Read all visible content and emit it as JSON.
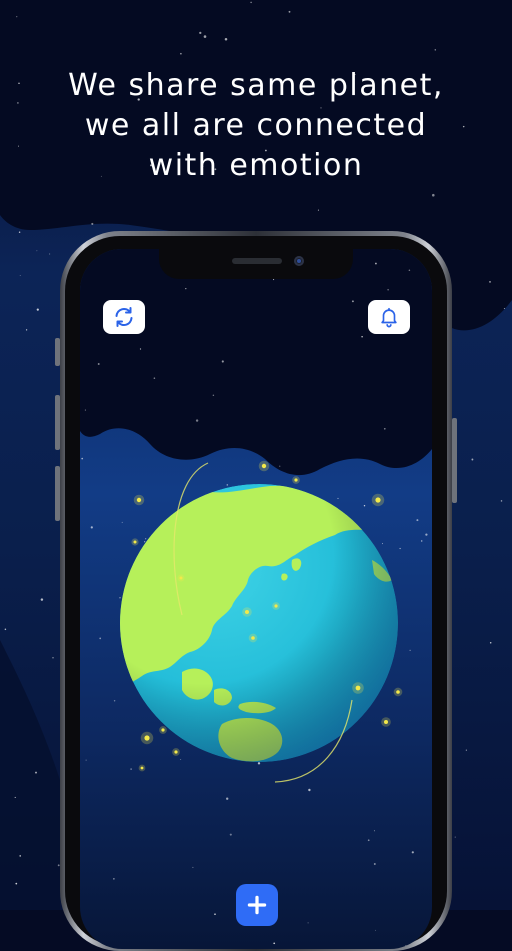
{
  "headline": {
    "line1": "We share same planet,",
    "line2": "we all are connected",
    "line3": "with emotion"
  },
  "colors": {
    "background": "#050b24",
    "screen_blue": "#123c86",
    "ocean": "#22c1dc",
    "land": "#b6f05a",
    "firefly": "#f3e94a",
    "add_button": "#2f6cf6",
    "icon_blue": "#2b63e8"
  },
  "icons": {
    "refresh": "refresh-icon",
    "bell": "bell-icon",
    "add": "plus-icon"
  }
}
